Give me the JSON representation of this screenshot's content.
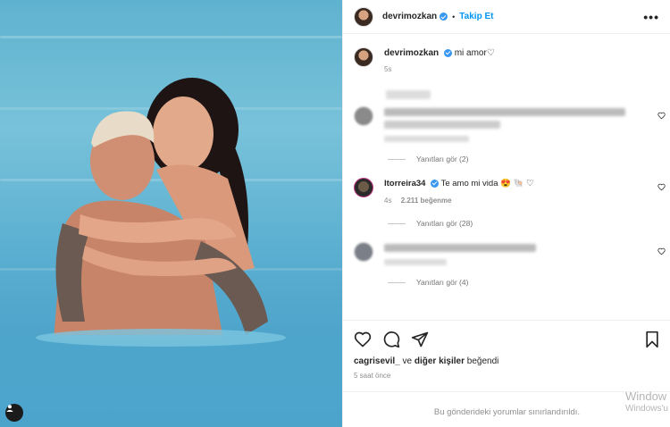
{
  "post": {
    "username": "devrimozkan",
    "follow_label": "Takip Et",
    "more_label": "•••"
  },
  "caption": {
    "username": "devrimozkan",
    "text": "mi amor♡",
    "time": "5s"
  },
  "comments": [
    {
      "username": "",
      "text": "",
      "meta": "",
      "replies_label": "Yanıtları gör (2)",
      "blurred": true
    },
    {
      "username": "ltorreira34",
      "text": "Te amo mi vida 😍 🐚 ♡",
      "time": "4s",
      "likes": "2.211 beğenme",
      "replies_label": "Yanıtları gör (28)",
      "blurred": false
    },
    {
      "username": "",
      "text": "",
      "meta": "",
      "replies_label": "Yanıtları gör (4)",
      "blurred": true
    }
  ],
  "footer": {
    "liked_by_user": "cagrisevil_",
    "liked_by_mid": " ve ",
    "liked_by_others": "diğer kişiler",
    "liked_by_suffix": " beğendi",
    "posted_time": "5 saat önce",
    "comments_limited": "Bu gönderideki yorumlar sınırlandırıldı."
  },
  "watermark": {
    "line1": "Window",
    "line2": "Windows'u"
  },
  "icons": [
    "user-tag-icon",
    "heart-icon",
    "comment-icon",
    "share-icon",
    "bookmark-icon",
    "verified-icon"
  ],
  "colors": {
    "link": "#0095f6",
    "verified": "#3897f0",
    "muted": "#8e8e8e"
  }
}
